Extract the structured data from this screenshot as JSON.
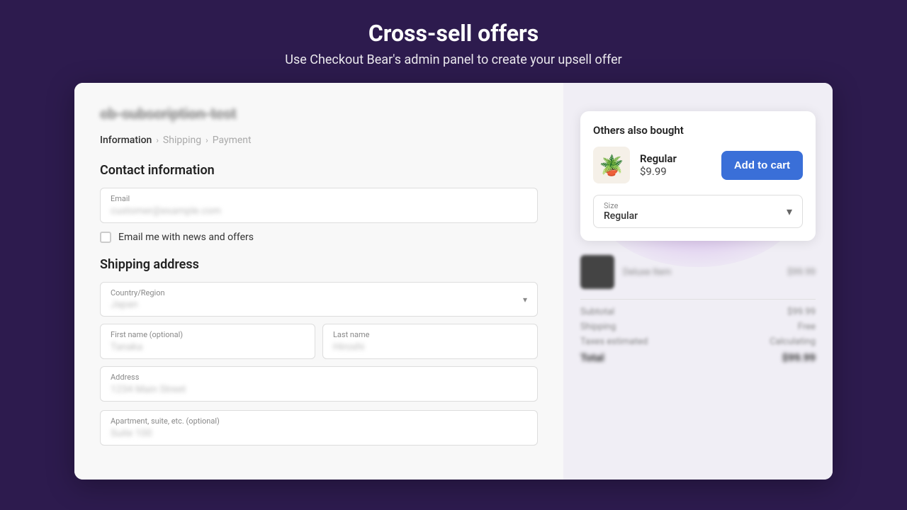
{
  "header": {
    "title": "Cross-sell offers",
    "subtitle": "Use Checkout Bear's admin panel to create your upsell offer"
  },
  "left": {
    "store_title": "cb-subscription-test",
    "breadcrumb": {
      "information": "Information",
      "shipping": "Shipping",
      "payment": "Payment"
    },
    "contact_section": "Contact information",
    "email_label": "Email",
    "email_placeholder": "customer@example.com",
    "checkbox_label": "Email me with news and offers",
    "shipping_section": "Shipping address",
    "country_label": "Country/Region",
    "country_value": "Japan",
    "first_name_label": "First name (optional)",
    "first_name_value": "Tanaka",
    "last_name_label": "Last name",
    "last_name_value": "Hiroshi",
    "address_label": "Address",
    "address_value": "1234 Main Street",
    "apartment_label": "Apartment, suite, etc. (optional)",
    "apartment_value": "Suite 100"
  },
  "right": {
    "offer_title": "Others also bought",
    "product_name": "Regular",
    "product_price": "$9.99",
    "product_emoji": "🪴",
    "add_to_cart_label": "Add to cart",
    "size_label": "Size",
    "size_value": "Regular",
    "order_item_name": "Deluxe Item",
    "order_item_price": "$99.99",
    "subtotal_label": "Subtotal",
    "subtotal_value": "$99.99",
    "shipping_label": "Shipping",
    "shipping_value": "Free",
    "taxes_label": "Taxes estimated",
    "taxes_value": "Calculating",
    "total_label": "Total",
    "total_value": "$99.99"
  }
}
